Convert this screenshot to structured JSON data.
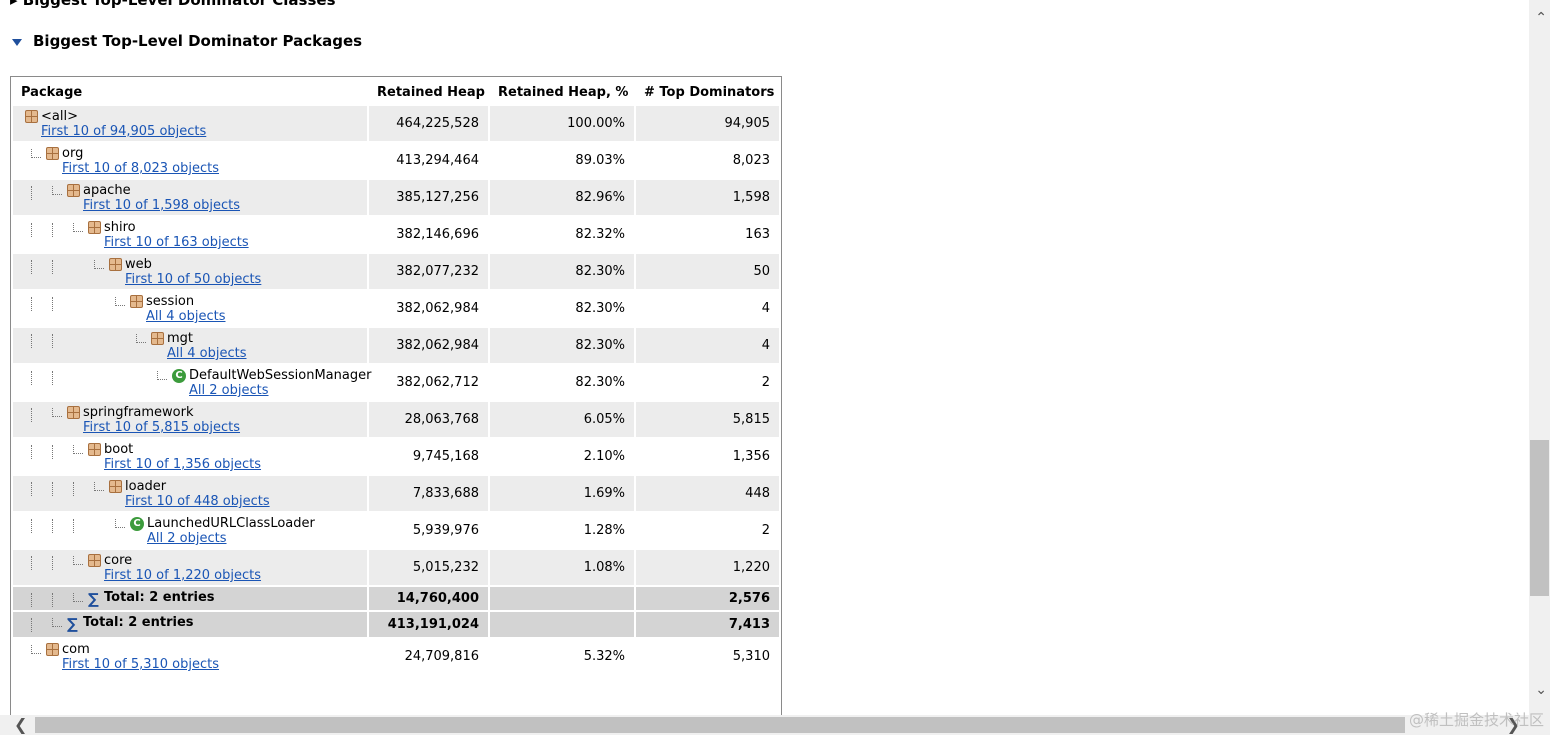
{
  "prev_heading": "Biggest Top-Level Dominator Classes",
  "heading": "Biggest Top-Level Dominator Packages",
  "columns": [
    "Package",
    "Retained Heap",
    "Retained Heap, %",
    "# Top Dominators"
  ],
  "rows": [
    {
      "name": "<all>",
      "link": "First 10 of 94,905 objects",
      "heap": "464,225,528",
      "pct": "100.00%",
      "dom": "94,905",
      "icon": "package"
    },
    {
      "name": "org",
      "link": "First 10 of 8,023 objects",
      "heap": "413,294,464",
      "pct": "89.03%",
      "dom": "8,023",
      "icon": "package"
    },
    {
      "name": "apache",
      "link": "First 10 of 1,598 objects",
      "heap": "385,127,256",
      "pct": "82.96%",
      "dom": "1,598",
      "icon": "package"
    },
    {
      "name": "shiro",
      "link": "First 10 of 163 objects",
      "heap": "382,146,696",
      "pct": "82.32%",
      "dom": "163",
      "icon": "package"
    },
    {
      "name": "web",
      "link": "First 10 of 50 objects",
      "heap": "382,077,232",
      "pct": "82.30%",
      "dom": "50",
      "icon": "package"
    },
    {
      "name": "session",
      "link": "All 4 objects",
      "heap": "382,062,984",
      "pct": "82.30%",
      "dom": "4",
      "icon": "package"
    },
    {
      "name": "mgt",
      "link": "All 4 objects",
      "heap": "382,062,984",
      "pct": "82.30%",
      "dom": "4",
      "icon": "package"
    },
    {
      "name": "DefaultWebSessionManager",
      "link": "All 2 objects",
      "heap": "382,062,712",
      "pct": "82.30%",
      "dom": "2",
      "icon": "class"
    },
    {
      "name": "springframework",
      "link": "First 10 of 5,815 objects",
      "heap": "28,063,768",
      "pct": "6.05%",
      "dom": "5,815",
      "icon": "package"
    },
    {
      "name": "boot",
      "link": "First 10 of 1,356 objects",
      "heap": "9,745,168",
      "pct": "2.10%",
      "dom": "1,356",
      "icon": "package"
    },
    {
      "name": "loader",
      "link": "First 10 of 448 objects",
      "heap": "7,833,688",
      "pct": "1.69%",
      "dom": "448",
      "icon": "package"
    },
    {
      "name": "LaunchedURLClassLoader",
      "link": "All 2 objects",
      "heap": "5,939,976",
      "pct": "1.28%",
      "dom": "2",
      "icon": "class"
    },
    {
      "name": "core",
      "link": "First 10 of 1,220 objects",
      "heap": "5,015,232",
      "pct": "1.08%",
      "dom": "1,220",
      "icon": "package"
    }
  ],
  "totals": [
    {
      "label": "Total: 2 entries",
      "heap": "14,760,400",
      "dom": "2,576"
    },
    {
      "label": "Total: 2 entries",
      "heap": "413,191,024",
      "dom": "7,413"
    }
  ],
  "last_row": {
    "name": "com",
    "link": "First 10 of 5,310 objects",
    "heap": "24,709,816",
    "pct": "5.32%",
    "dom": "5,310",
    "icon": "package"
  },
  "class_icon_letter": "C",
  "sum_symbol": "∑",
  "watermark": "@稀土掘金技术社区"
}
